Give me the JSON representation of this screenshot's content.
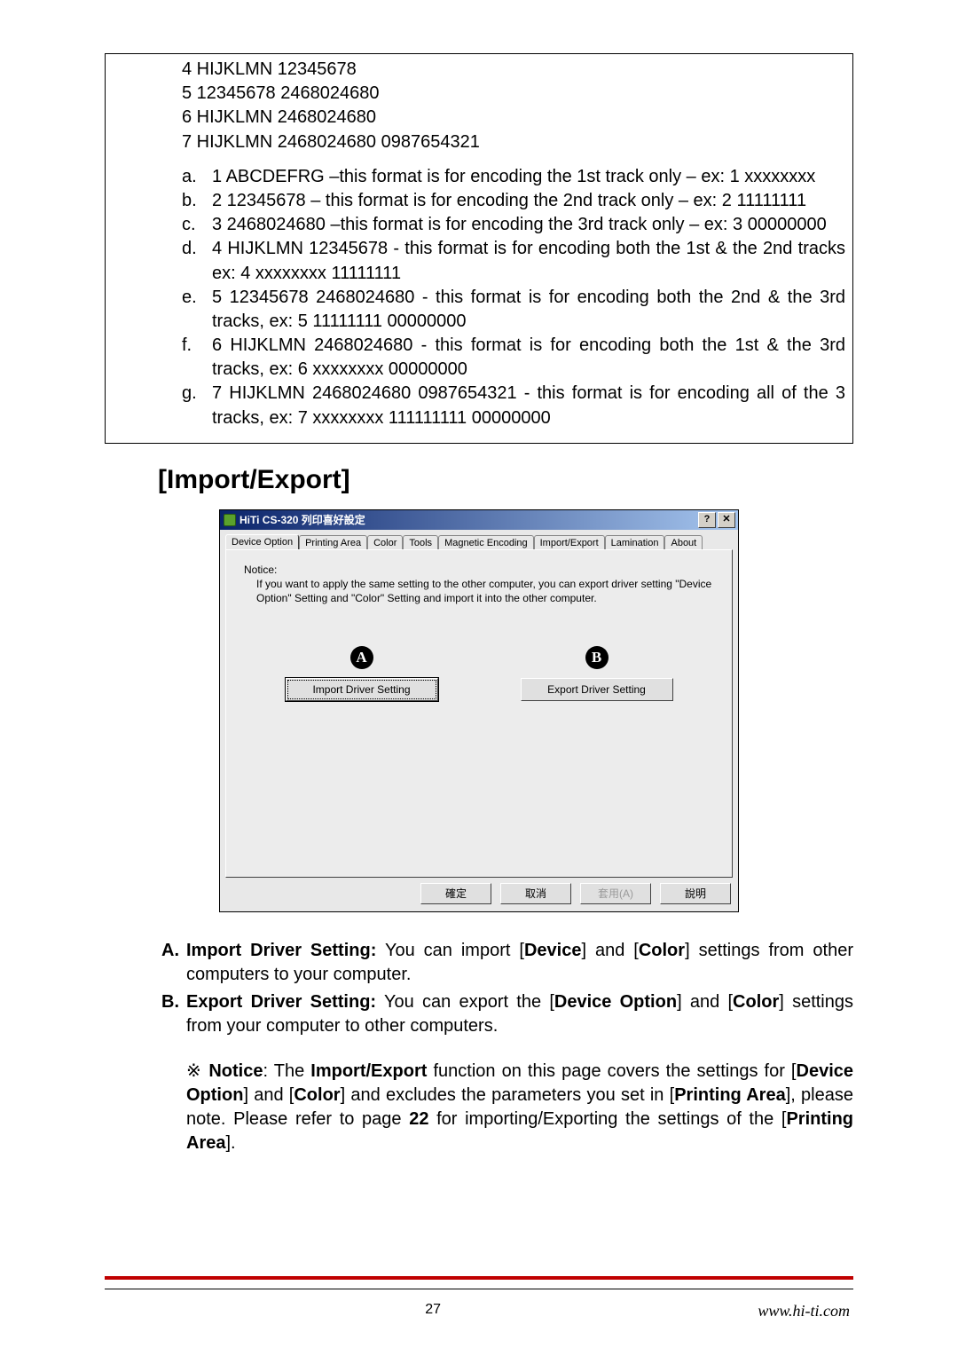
{
  "encoding_lines": {
    "l4": "4 HIJKLMN 12345678",
    "l5": "5 12345678 2468024680",
    "l6": "6 HIJKLMN 2468024680",
    "l7": "7 HIJKLMN 2468024680 0987654321"
  },
  "letters": {
    "a": "1 ABCDEFRG –this format is for encoding the 1st track only – ex: 1 xxxxxxxx",
    "b": "2 12345678 – this format is for encoding the 2nd track only – ex: 2 11111111",
    "c": "3 2468024680 –this format is for encoding the 3rd track only – ex: 3 00000000",
    "d": "4 HIJKLMN 12345678 - this format is for encoding both the 1st & the 2nd tracks ex: 4 xxxxxxxx 11111111",
    "e": "5 12345678 2468024680 - this format is for encoding both the 2nd & the 3rd tracks, ex: 5 11111111 00000000",
    "f": "6 HIJKLMN 2468024680 - this format is for encoding both the 1st & the 3rd tracks, ex: 6 xxxxxxxx 00000000",
    "g": "7 HIJKLMN 2468024680 0987654321 - this format is for encoding all of the 3 tracks, ex: 7 xxxxxxxx 111111111 00000000"
  },
  "section_heading": "[Import/Export]",
  "dialog": {
    "title": "HiTi CS-320 列印喜好設定",
    "help_btn": "?",
    "close_btn": "✕",
    "tabs": {
      "device_option": "Device Option",
      "printing_area": "Printing Area",
      "color": "Color",
      "tools": "Tools",
      "magnetic": "Magnetic Encoding",
      "import_export": "Import/Export",
      "lamination": "Lamination",
      "about": "About"
    },
    "notice_label": "Notice:",
    "notice_body": "If you want to apply the same setting to the other computer, you can export driver setting \"Device Option\" Setting and \"Color\" Setting and import it into the other computer.",
    "marker_a": "A",
    "marker_b": "B",
    "import_btn": "Import Driver Setting",
    "export_btn": "Export Driver Setting",
    "ok": "確定",
    "cancel": "取消",
    "apply": "套用(A)",
    "help": "說明"
  },
  "below": {
    "a_label": "A.",
    "a_bold": "Import Driver Setting:",
    "a_rest_1": " You can import [",
    "a_bold2": "Device",
    "a_rest_2": "] and [",
    "a_bold3": "Color",
    "a_rest_3": "] settings from other computers to your computer.",
    "b_label": "B.",
    "b_bold": "Export Driver Setting:",
    "b_rest_1": " You can export the [",
    "b_bold2": "Device Option",
    "b_rest_2": "] and [",
    "b_bold3": "Color",
    "b_rest_3": "] settings from your computer to other computers.",
    "note_sym": "※ ",
    "note_bold": "Notice",
    "note_rest_1": ": The ",
    "note_bold2": "Import/Export",
    "note_rest_2": " function on this page covers the settings for [",
    "note_bold3": "Device Option",
    "note_rest_3": "] and [",
    "note_bold4": "Color",
    "note_rest_4": "] and excludes the parameters you set in [",
    "note_bold5": "Printing Area",
    "note_rest_5": "], please note. Please refer to page ",
    "note_bold6": "22",
    "note_rest_6": " for importing/Exporting the settings of the [",
    "note_bold7": "Printing Area",
    "note_rest_7": "]."
  },
  "footer": {
    "page_no": "27",
    "url": "www.hi-ti.com"
  }
}
